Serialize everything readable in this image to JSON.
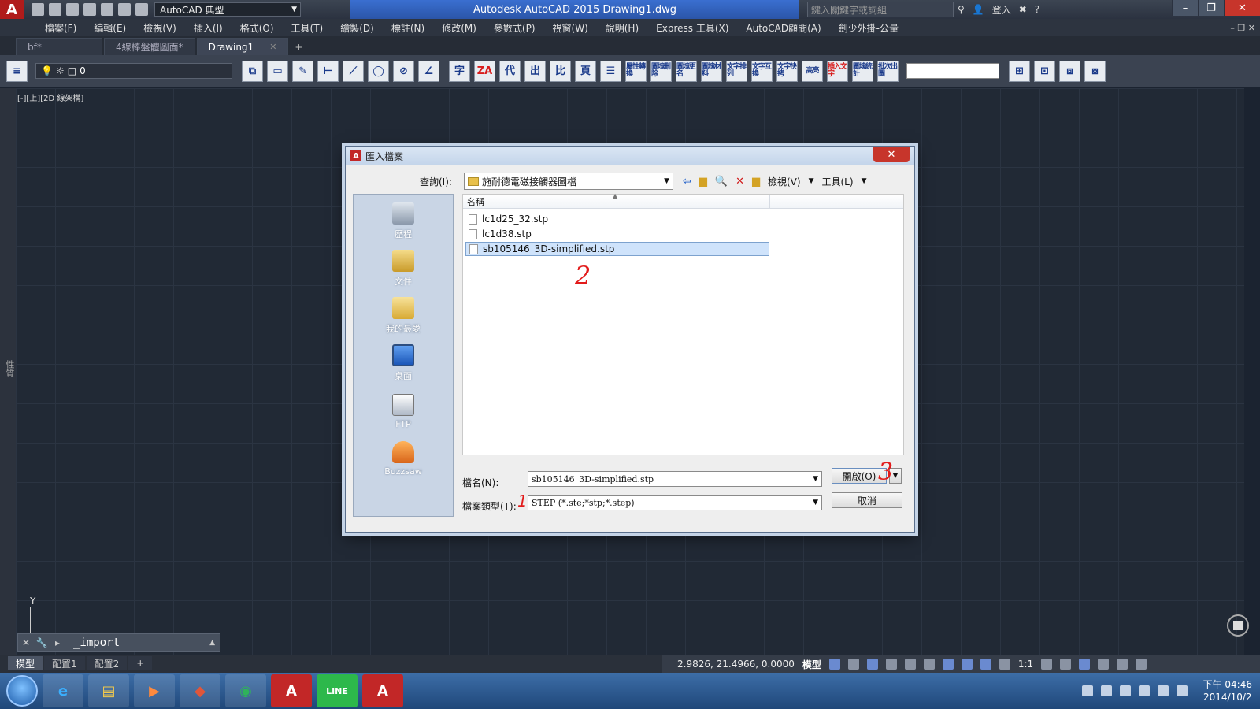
{
  "titlebar": {
    "workspace": "AutoCAD 典型",
    "title": "Autodesk AutoCAD 2015    Drawing1.dwg",
    "search_placeholder": "鍵入關鍵字或詞組",
    "signin": "登入"
  },
  "menu": [
    "檔案(F)",
    "編輯(E)",
    "檢視(V)",
    "插入(I)",
    "格式(O)",
    "工具(T)",
    "繪製(D)",
    "標註(N)",
    "修改(M)",
    "參數式(P)",
    "視窗(W)",
    "說明(H)",
    "Express 工具(X)",
    "AutoCAD顧問(A)",
    "劍少外掛-公量"
  ],
  "file_tabs": [
    {
      "label": "bf*"
    },
    {
      "label": "4線棒盤體圖面*"
    },
    {
      "label": "Drawing1"
    }
  ],
  "toolbar": {
    "layer_value": "0",
    "icons": [
      {
        "name": "zh-char-icon",
        "glyph": "字",
        "red": false
      },
      {
        "name": "za-text-icon",
        "glyph": "ZA",
        "red": true
      },
      {
        "name": "replace-char-icon",
        "glyph": "代",
        "red": false
      },
      {
        "name": "out-char-icon",
        "glyph": "出",
        "red": false
      },
      {
        "name": "compare-char-icon",
        "glyph": "比",
        "red": false
      },
      {
        "name": "page-char-icon",
        "glyph": "頁",
        "red": false
      },
      {
        "name": "list-lines-icon",
        "glyph": "☰",
        "red": false
      },
      {
        "name": "attr-convert-icon",
        "glyph": "屬性轉換",
        "red": false,
        "small": true
      },
      {
        "name": "block-delete-icon",
        "glyph": "圖塊刪除",
        "red": false,
        "small": true
      },
      {
        "name": "block-rename-icon",
        "glyph": "圖塊更名",
        "red": false,
        "small": true
      },
      {
        "name": "block-material-icon",
        "glyph": "圖塊材料",
        "red": false,
        "small": true
      },
      {
        "name": "text-arrange-icon",
        "glyph": "文字排列",
        "red": false,
        "small": true
      },
      {
        "name": "text-swap-icon",
        "glyph": "文字互換",
        "red": false,
        "small": true
      },
      {
        "name": "text-copy-icon",
        "glyph": "文字快拷",
        "red": false,
        "small": true
      },
      {
        "name": "highlight-icon",
        "glyph": "高亮",
        "red": false,
        "small": true
      },
      {
        "name": "insert-text-icon",
        "glyph": "插入文字",
        "red": true,
        "small": true
      },
      {
        "name": "block-stats-icon",
        "glyph": "圖塊統計",
        "red": false,
        "small": true
      },
      {
        "name": "batch-plot-icon",
        "glyph": "批次出圖",
        "red": false,
        "small": true
      }
    ]
  },
  "canvas": {
    "view_label": "[-][上][2D 線架構]",
    "ucs_y": "Y",
    "side_label": "性質"
  },
  "command_line": {
    "text": "_import"
  },
  "layout_tabs": [
    "模型",
    "配置1",
    "配置2"
  ],
  "statusbar": {
    "coords": "2.9826, 21.4966, 0.0000",
    "model": "模型",
    "scale": "1:1"
  },
  "taskbar": {
    "line_label": "LINE",
    "time": "下午 04:46",
    "date": "2014/10/2"
  },
  "dialog": {
    "title": "匯入檔案",
    "lookin_label": "查詢(I):",
    "lookin_value": "施耐德電磁接觸器圖檔",
    "views_label": "檢視(V)",
    "tools_label": "工具(L)",
    "places": [
      {
        "label": "歷程",
        "icon": "history-icon",
        "cls": "history"
      },
      {
        "label": "文件",
        "icon": "documents-icon",
        "cls": "docs"
      },
      {
        "label": "我的最愛",
        "icon": "favorites-icon",
        "cls": "fav"
      },
      {
        "label": "桌面",
        "icon": "desktop-icon",
        "cls": "desk"
      },
      {
        "label": "FTP",
        "icon": "ftp-icon",
        "cls": "ftp"
      },
      {
        "label": "Buzzsaw",
        "icon": "buzzsaw-icon",
        "cls": "buzz"
      }
    ],
    "column_name": "名稱",
    "files": [
      {
        "name": "lc1d25_32.stp",
        "selected": false
      },
      {
        "name": "lc1d38.stp",
        "selected": false
      },
      {
        "name": "sb105146_3D-simplified.stp",
        "selected": true
      }
    ],
    "filename_label": "檔名(N):",
    "filename_value": "sb105146_3D-simplified.stp",
    "filetype_label": "檔案類型(T):",
    "filetype_value": "STEP (*.ste;*stp;*.step)",
    "open_label": "開啟(O)",
    "cancel_label": "取消",
    "annotations": {
      "one": "1",
      "two": "2",
      "three": "3"
    }
  }
}
